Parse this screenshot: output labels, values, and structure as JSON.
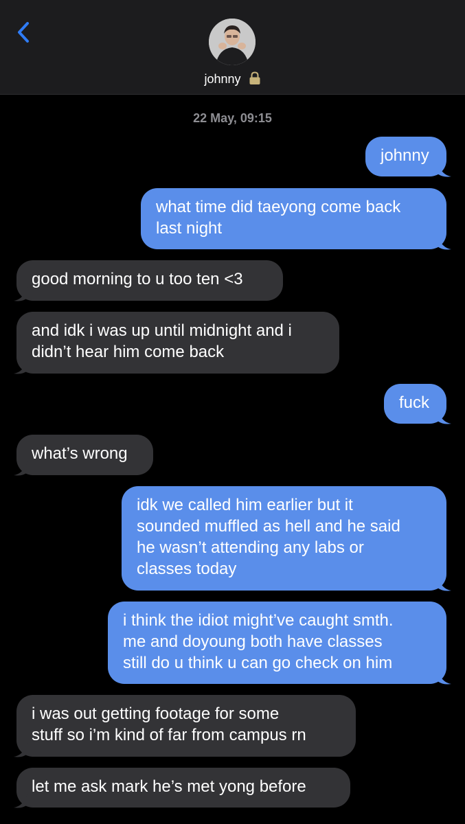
{
  "header": {
    "contact_name": "johnny",
    "back_icon": "chevron-left-icon",
    "lock_icon": "lock-icon",
    "accent_color": "#2f7cf6"
  },
  "timestamp": "22 May, 09:15",
  "colors": {
    "outgoing": "#5a8eea",
    "incoming": "#333336",
    "background": "#000000"
  },
  "messages": [
    {
      "dir": "out",
      "text": "johnny"
    },
    {
      "dir": "out",
      "text": "what time did taeyong come back\nlast night"
    },
    {
      "dir": "in",
      "text": "good morning to u too ten <3"
    },
    {
      "dir": "in",
      "text": "and idk i was up until midnight and i\ndidn’t hear him come back"
    },
    {
      "dir": "out",
      "text": "fuck"
    },
    {
      "dir": "in",
      "text": "what’s wrong"
    },
    {
      "dir": "out",
      "text": "idk we called him earlier but it\nsounded muffled as hell and he said\nhe wasn’t attending any labs or\nclasses today"
    },
    {
      "dir": "out",
      "text": "i think the idiot might’ve caught smth.\nme and doyoung both have classes\nstill do u think u can go check on him"
    },
    {
      "dir": "in",
      "text": "i was out getting footage for some\nstuff so i’m kind of far from campus rn"
    },
    {
      "dir": "in",
      "text": "let me ask mark he’s met yong before"
    }
  ]
}
